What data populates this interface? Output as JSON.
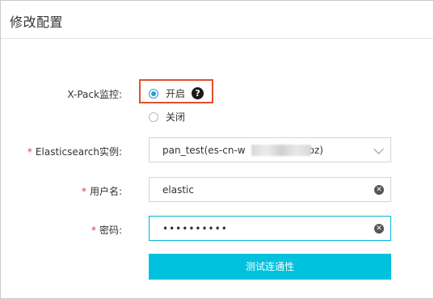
{
  "header": {
    "title": "修改配置"
  },
  "xpack": {
    "label": "X-Pack监控:",
    "options": [
      {
        "label": "开启",
        "checked": true
      },
      {
        "label": "关闭",
        "checked": false
      }
    ],
    "help_icon": "question-circle-icon"
  },
  "instance": {
    "label": "Elasticsearch实例:",
    "value_prefix": "pan_test(es-cn-w",
    "value_suffix": "oz)",
    "icon": "chevron-down-icon"
  },
  "username": {
    "label": "用户名:",
    "value": "elastic",
    "icon": "clear-icon"
  },
  "password": {
    "label": "密码:",
    "masked_value": "••••••••••",
    "icon": "clear-icon"
  },
  "actions": {
    "test_connection_label": "测试连通性"
  },
  "colors": {
    "accent": "#00c1de",
    "radio_checked": "#1fa2d6",
    "required": "#e4393c",
    "highlight_box": "#e0502e"
  }
}
